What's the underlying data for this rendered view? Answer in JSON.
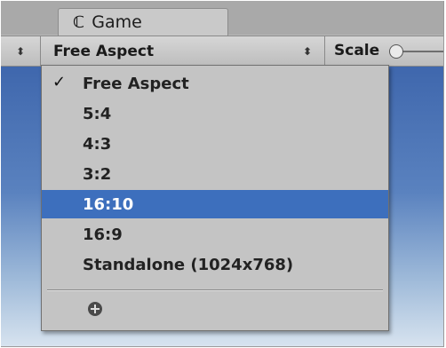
{
  "window": {
    "tab_label": "Game",
    "tab_icon": "game-controller-icon"
  },
  "toolbar": {
    "display_dropdown_arrow": "⬍",
    "aspect_selected": "Free Aspect",
    "aspect_arrow": "⬍",
    "scale_label": "Scale"
  },
  "menu": {
    "checked_index": 0,
    "highlighted_index": 4,
    "items": [
      {
        "label": "Free Aspect"
      },
      {
        "label": "5:4"
      },
      {
        "label": "4:3"
      },
      {
        "label": "3:2"
      },
      {
        "label": "16:10"
      },
      {
        "label": "16:9"
      },
      {
        "label": "Standalone (1024x768)"
      }
    ],
    "check_mark": "✓",
    "add_icon": "add-circle-icon"
  },
  "colors": {
    "highlight": "#3d6fbd",
    "menu_bg": "#c4c4c4",
    "sky_top": "#3f67ad",
    "sky_bottom": "#d7e3ef"
  }
}
